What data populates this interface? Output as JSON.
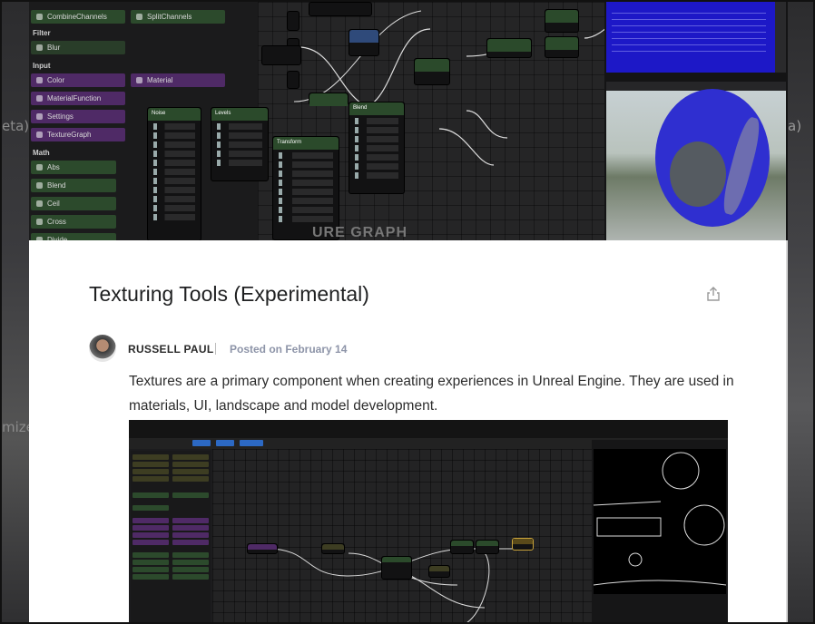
{
  "background": {
    "left_fragments": [
      "eta)",
      "mize"
    ],
    "right_fragment": "a)"
  },
  "hero_image": {
    "palette": {
      "top_buttons": [
        "CombineChannels",
        "SplitChannels"
      ],
      "sections": [
        {
          "label": "Filter"
        },
        {
          "label": "Input"
        },
        {
          "label": "Math"
        }
      ],
      "filter_items": [
        "Blur"
      ],
      "input_items_left": [
        "Color",
        "MaterialFunction",
        "Settings",
        "TextureGraph"
      ],
      "input_items_right": [
        "Material"
      ],
      "math_items": [
        "Abs",
        "Blend",
        "Ceil",
        "Cross",
        "Divide"
      ]
    },
    "nodes": [
      "Noise",
      "Levels",
      "Transform",
      "Blend"
    ],
    "watermark": "URE GRAPH"
  },
  "article": {
    "title": "Texturing Tools (Experimental)",
    "author": "RUSSELL PAUL",
    "posted": "Posted on February 14",
    "body": "Textures are a primary component when creating experiences in Unreal Engine. They are used in materials, UI, landscape and model development."
  },
  "colors": {
    "accent_purple": "#4f2a66",
    "accent_green": "#2c4a2c",
    "preview_blue": "#1d18c7",
    "meta_gray": "#8d94a8"
  },
  "icons": {
    "share": "share-icon"
  }
}
